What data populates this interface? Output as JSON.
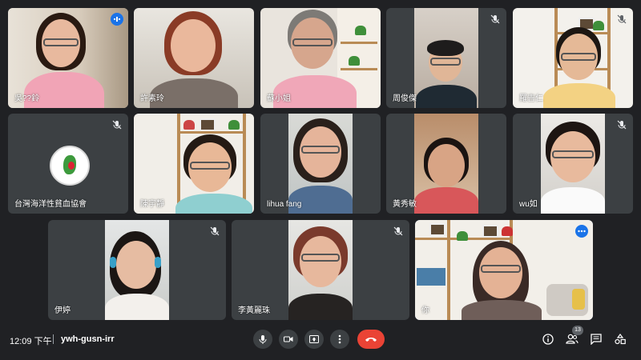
{
  "participants": [
    {
      "name": "吳??鈴",
      "speaking": true
    },
    {
      "name": "許素玲"
    },
    {
      "name": "蘇小姐"
    },
    {
      "name": "周俊傑"
    },
    {
      "name": "羅吉仁"
    },
    {
      "name": "台灣海洋性貧血協會"
    },
    {
      "name": "陳宇靜"
    },
    {
      "name": "lihua fang"
    },
    {
      "name": "黃秀敏"
    },
    {
      "name": "wu如"
    },
    {
      "name": "伊婷"
    },
    {
      "name": "李黃麗珠"
    },
    {
      "name": "你"
    }
  ],
  "meeting": {
    "time": "12:09 下午",
    "code": "ywh-gusn-irr"
  },
  "people_count": "13",
  "icons": {
    "mic": "mic-icon",
    "camera": "camera-icon",
    "present": "present-icon",
    "more": "more-vert-icon",
    "end": "end-call-icon",
    "info": "info-icon",
    "people": "people-icon",
    "chat": "chat-icon",
    "activities": "activities-icon"
  },
  "colors": {
    "background": "#202124",
    "tile": "#3c4043",
    "end_call": "#ea4335",
    "accent": "#1a73e8"
  }
}
